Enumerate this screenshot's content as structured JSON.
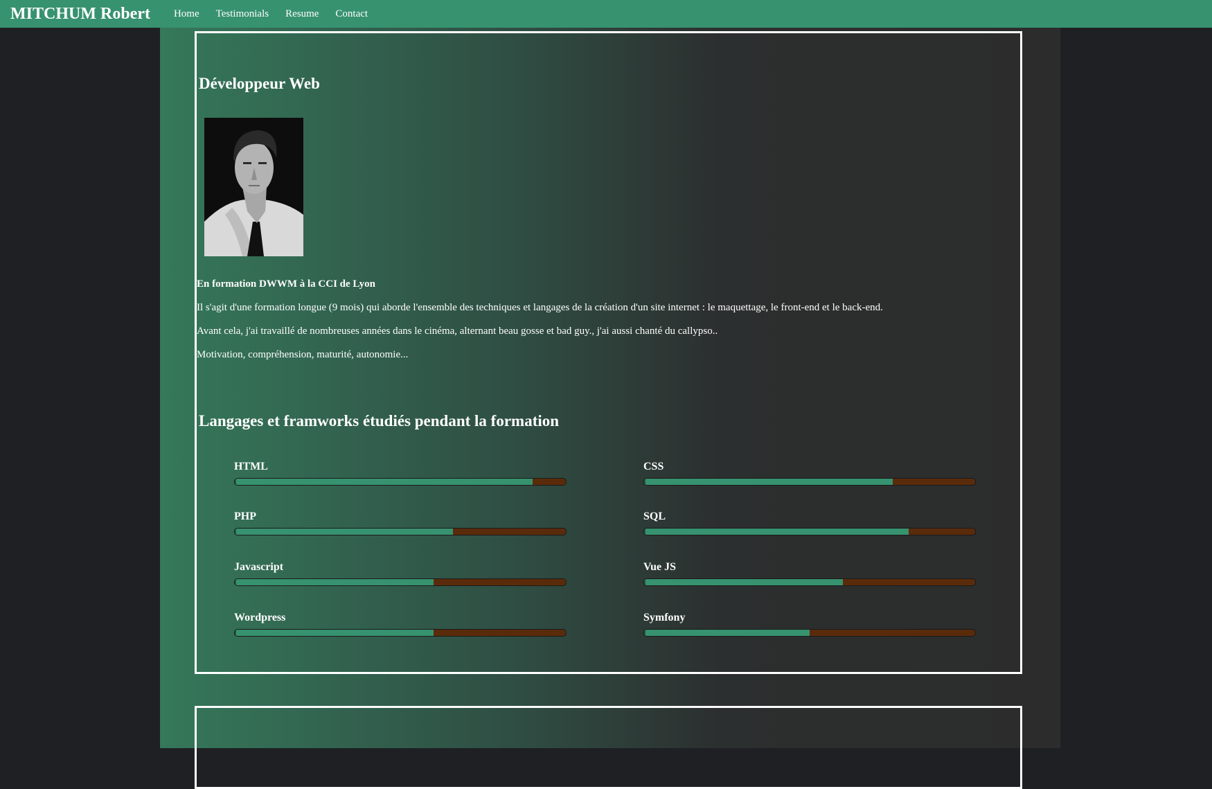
{
  "nav": {
    "brand": "MITCHUM Robert",
    "links": [
      "Home",
      "Testimonials",
      "Resume",
      "Contact"
    ]
  },
  "about": {
    "title": "Développeur Web",
    "portrait_alt": "portrait",
    "lead": "En formation DWWM à la CCI de Lyon",
    "paragraphs": [
      "Il s'agit d'une formation longue (9 mois) qui aborde l'ensemble des techniques et langages de la création d'un site internet : le maquettage, le front-end et le back-end.",
      "Avant cela, j'ai travaillé de nombreuses années dans le cinéma, alternant beau gosse et bad guy., j'ai aussi chanté du callypso..",
      "Motivation, compréhension, maturité, autonomie..."
    ]
  },
  "skills": {
    "title": "Langages et framworks étudiés pendant la formation",
    "items": [
      {
        "name": "HTML",
        "level": 0.9
      },
      {
        "name": "CSS",
        "level": 0.75
      },
      {
        "name": "PHP",
        "level": 0.66
      },
      {
        "name": "SQL",
        "level": 0.8
      },
      {
        "name": "Javascript",
        "level": 0.6
      },
      {
        "name": "Vue JS",
        "level": 0.6
      },
      {
        "name": "Wordpress",
        "level": 0.6
      },
      {
        "name": "Symfony",
        "level": 0.5
      }
    ]
  },
  "colors": {
    "navbar": "#37926f",
    "bar_fill": "#37926f",
    "bar_track": "#5a2b0a",
    "page_background": "#1e2024"
  }
}
